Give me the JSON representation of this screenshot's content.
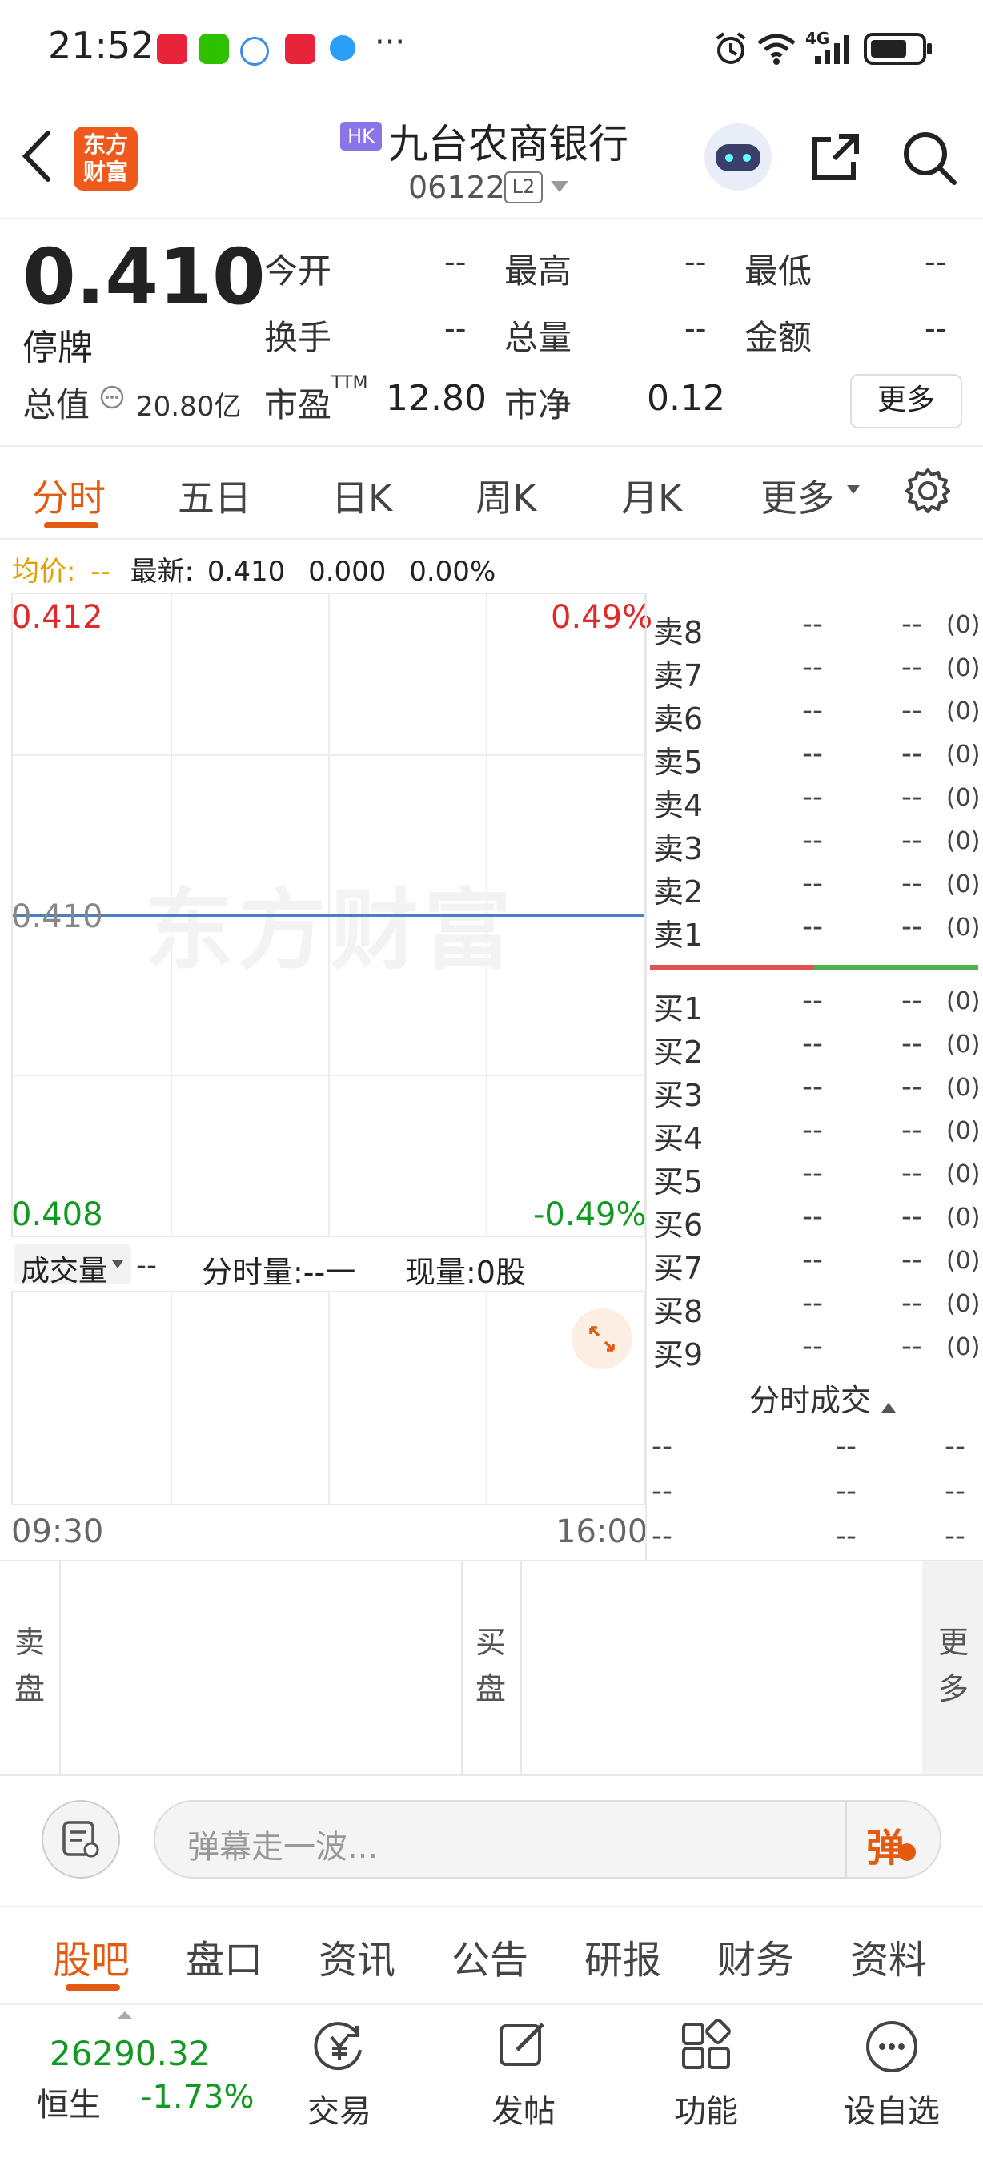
{
  "status_bar": {
    "time": "21:52",
    "app_icons": [
      "xiaohongshu-icon",
      "wechat-icon",
      "chat-bubble-icon",
      "lottery-app-icon",
      "browser-icon"
    ],
    "overflow": "···",
    "network": "4G"
  },
  "header": {
    "logo_text": "东方\n财富",
    "market_badge": "HK",
    "stock_name": "九台农商银行",
    "stock_code": "06122",
    "level_badge": "L2"
  },
  "quote": {
    "price": "0.410",
    "status": "停牌",
    "stats": [
      {
        "label": "今开",
        "value": "--"
      },
      {
        "label": "最高",
        "value": "--"
      },
      {
        "label": "最低",
        "value": "--"
      },
      {
        "label": "换手",
        "value": "--"
      },
      {
        "label": "总量",
        "value": "--"
      },
      {
        "label": "金额",
        "value": "--"
      }
    ],
    "market_cap_label": "总值",
    "market_cap_value": "20.80亿",
    "pe_label": "市盈",
    "pe_sup": "TTM",
    "pe_value": "12.80",
    "pb_label": "市净",
    "pb_value": "0.12",
    "more_label": "更多"
  },
  "chart_tabs": {
    "items": [
      "分时",
      "五日",
      "日K",
      "周K",
      "月K",
      "更多"
    ],
    "active": "分时"
  },
  "avg_line": {
    "avg_label": "均价:",
    "avg_value": "--",
    "latest_label": "最新:",
    "latest_value": "0.410",
    "change": "0.000",
    "change_pct": "0.00%"
  },
  "chart": {
    "top_price": "0.412",
    "top_pct": "0.49%",
    "mid_price": "0.410",
    "bottom_price": "0.408",
    "bottom_pct": "-0.49%",
    "watermark": "东方财富",
    "start_time": "09:30",
    "end_time": "16:00",
    "volume_selector": "成交量",
    "volume_dash": "--",
    "fenshi_vol": "分时量:--一",
    "current_vol": "现量:0股"
  },
  "order_book": {
    "sell": [
      {
        "label": "卖8",
        "price": "--",
        "vol": "--",
        "count": "(0)"
      },
      {
        "label": "卖7",
        "price": "--",
        "vol": "--",
        "count": "(0)"
      },
      {
        "label": "卖6",
        "price": "--",
        "vol": "--",
        "count": "(0)"
      },
      {
        "label": "卖5",
        "price": "--",
        "vol": "--",
        "count": "(0)"
      },
      {
        "label": "卖4",
        "price": "--",
        "vol": "--",
        "count": "(0)"
      },
      {
        "label": "卖3",
        "price": "--",
        "vol": "--",
        "count": "(0)"
      },
      {
        "label": "卖2",
        "price": "--",
        "vol": "--",
        "count": "(0)"
      },
      {
        "label": "卖1",
        "price": "--",
        "vol": "--",
        "count": "(0)"
      }
    ],
    "buy": [
      {
        "label": "买1",
        "price": "--",
        "vol": "--",
        "count": "(0)"
      },
      {
        "label": "买2",
        "price": "--",
        "vol": "--",
        "count": "(0)"
      },
      {
        "label": "买3",
        "price": "--",
        "vol": "--",
        "count": "(0)"
      },
      {
        "label": "买4",
        "price": "--",
        "vol": "--",
        "count": "(0)"
      },
      {
        "label": "买5",
        "price": "--",
        "vol": "--",
        "count": "(0)"
      },
      {
        "label": "买6",
        "price": "--",
        "vol": "--",
        "count": "(0)"
      },
      {
        "label": "买7",
        "price": "--",
        "vol": "--",
        "count": "(0)"
      },
      {
        "label": "买8",
        "price": "--",
        "vol": "--",
        "count": "(0)"
      },
      {
        "label": "买9",
        "price": "--",
        "vol": "--",
        "count": "(0)"
      }
    ],
    "trades_title": "分时成交",
    "trades": [
      [
        "--",
        "--",
        "--"
      ],
      [
        "--",
        "--",
        "--"
      ],
      [
        "--",
        "--",
        "--"
      ]
    ]
  },
  "panels": {
    "sell_label": "卖\n盘",
    "buy_label": "买\n盘",
    "more_label": "更\n多"
  },
  "danmaku": {
    "placeholder": "弹幕走一波...",
    "send_label": "弹"
  },
  "bottom_tabs": {
    "items": [
      "股吧",
      "盘口",
      "资讯",
      "公告",
      "研报",
      "财务",
      "资料"
    ],
    "active": "股吧"
  },
  "nav": {
    "index_value": "26290.32",
    "index_name": "恒生",
    "index_change": "-1.73%",
    "items": [
      {
        "label": "交易",
        "icon": "yen-circle-icon"
      },
      {
        "label": "发帖",
        "icon": "edit-icon"
      },
      {
        "label": "功能",
        "icon": "grid-icon"
      },
      {
        "label": "设自选",
        "icon": "more-dots-icon"
      }
    ]
  },
  "colors": {
    "accent": "#e45a10",
    "up": "#e02a2a",
    "down": "#119922"
  }
}
